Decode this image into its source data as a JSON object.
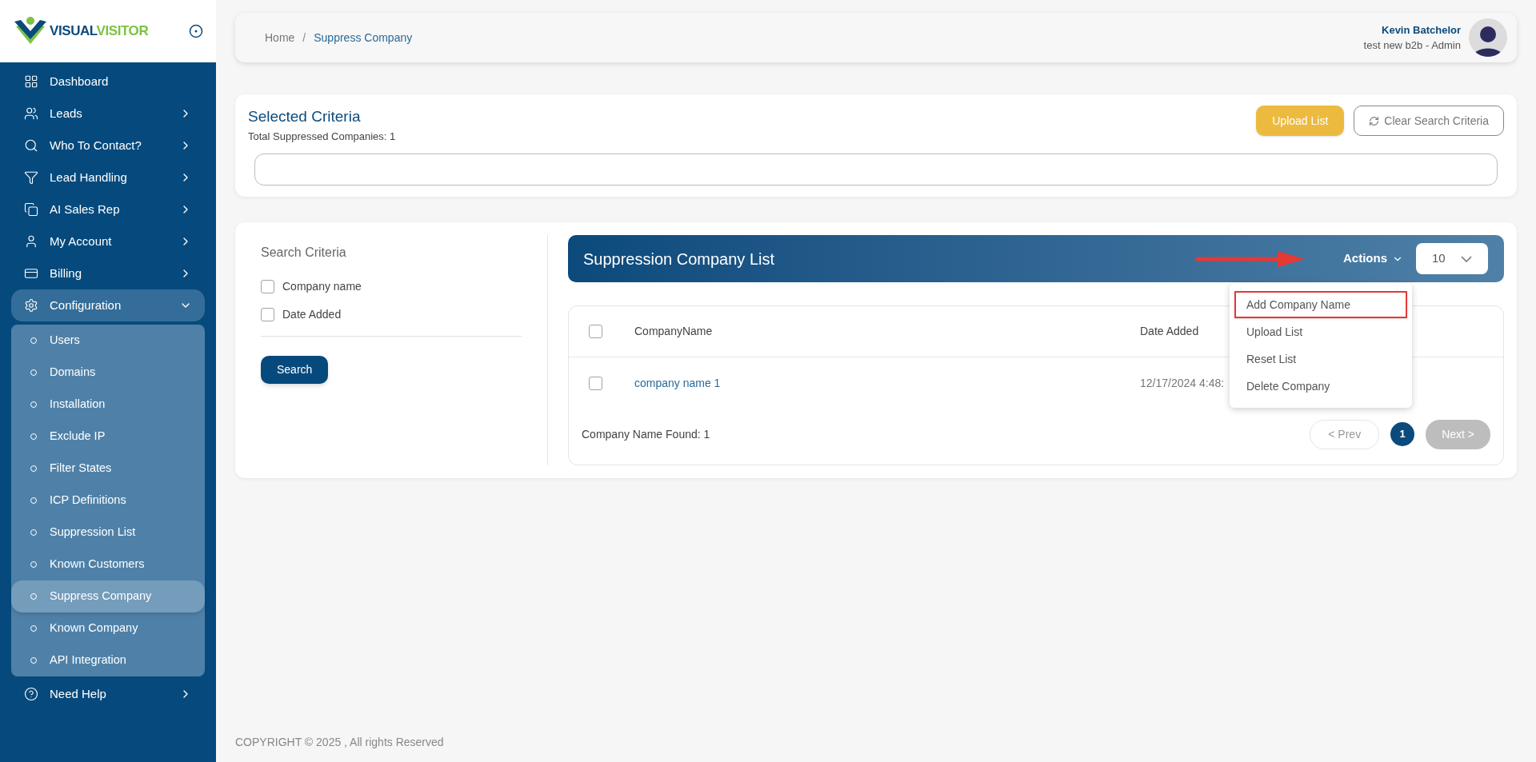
{
  "brand": {
    "part_1": "VISUAL",
    "part_2": "VISITOR"
  },
  "sidebar": {
    "items": [
      {
        "label": "Dashboard",
        "kind": "link"
      },
      {
        "label": "Leads",
        "kind": "group",
        "expanded": false
      },
      {
        "label": "Who To Contact?",
        "kind": "group",
        "expanded": false
      },
      {
        "label": "Lead Handling",
        "kind": "group",
        "expanded": false
      },
      {
        "label": "AI Sales Rep",
        "kind": "group",
        "expanded": false
      },
      {
        "label": "My Account",
        "kind": "group",
        "expanded": false
      },
      {
        "label": "Billing",
        "kind": "group",
        "expanded": false
      },
      {
        "label": "Configuration",
        "kind": "group",
        "expanded": true,
        "children": [
          {
            "label": "Users",
            "selected": false
          },
          {
            "label": "Domains",
            "selected": false
          },
          {
            "label": "Installation",
            "selected": false
          },
          {
            "label": "Exclude IP",
            "selected": false
          },
          {
            "label": "Filter States",
            "selected": false
          },
          {
            "label": "ICP Definitions",
            "selected": false
          },
          {
            "label": "Suppression List",
            "selected": false
          },
          {
            "label": "Known Customers",
            "selected": false
          },
          {
            "label": "Suppress Company",
            "selected": true
          },
          {
            "label": "Known Company",
            "selected": false
          },
          {
            "label": "API Integration",
            "selected": false
          }
        ]
      },
      {
        "label": "Need Help",
        "kind": "group",
        "expanded": false
      }
    ]
  },
  "header": {
    "breadcrumb": [
      "Home",
      "Suppress Company"
    ],
    "breadcrumb_separator": "/",
    "user_name": "Kevin Batchelor",
    "user_role": "test new b2b - Admin"
  },
  "criteria": {
    "title": "Selected Criteria",
    "subtitle": "Total Suppressed Companies: 1",
    "upload_button": "Upload List",
    "clear_button": "Clear Search Criteria"
  },
  "search_panel": {
    "title": "Search Criteria",
    "options": [
      {
        "label": "Company name",
        "checked": false
      },
      {
        "label": "Date Added",
        "checked": false
      }
    ],
    "button": "Search"
  },
  "list": {
    "title": "Suppression Company List",
    "actions_label": "Actions",
    "page_size": "10",
    "menu": [
      {
        "label": "Add Company Name",
        "selected": true
      },
      {
        "label": "Upload List",
        "selected": false
      },
      {
        "label": "Reset List",
        "selected": false
      },
      {
        "label": "Delete Company",
        "selected": false
      }
    ],
    "table": {
      "select_all_checked": false,
      "columns": [
        "CompanyName",
        "Date Added"
      ],
      "rows": [
        {
          "checked": false,
          "cells": [
            "company name 1",
            "12/17/2024 4:48:"
          ]
        }
      ]
    },
    "found": "Company Name Found: 1",
    "prev": "< Prev",
    "pages": [
      {
        "label": "1",
        "selected": true
      }
    ],
    "next": {
      "label": "Next >",
      "disabled": true
    }
  },
  "footer": "COPYRIGHT © 2025 , All rights Reserved"
}
